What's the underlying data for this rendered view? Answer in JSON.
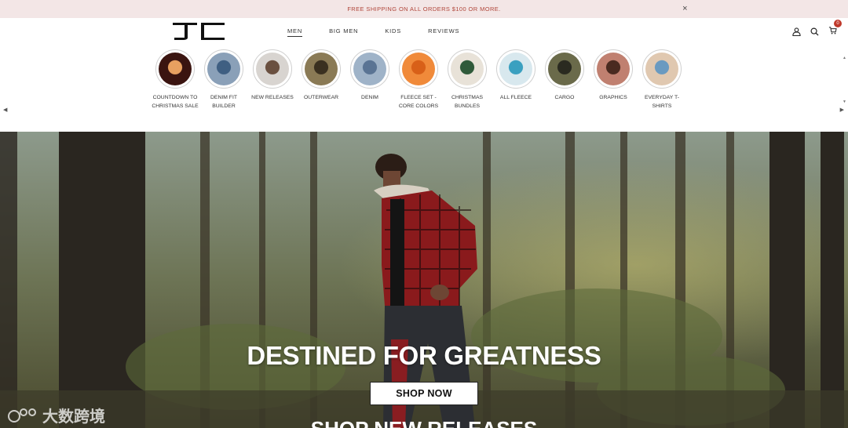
{
  "announcement": {
    "text": "FREE SHIPPING ON ALL ORDERS $100 OR MORE.",
    "close": "×"
  },
  "nav": {
    "items": [
      "MEN",
      "BIG MEN",
      "KIDS",
      "REVIEWS"
    ],
    "active": "MEN"
  },
  "cart": {
    "count": "0"
  },
  "categories": [
    {
      "label": "COUNTDOWN TO CHRISTMAS SALE",
      "color": "#3a1410",
      "accent": "#e8a060"
    },
    {
      "label": "DENIM FIT BUILDER",
      "color": "#8aa0b8",
      "accent": "#3f5f82"
    },
    {
      "label": "NEW RELEASES",
      "color": "#d8d4d0",
      "accent": "#6a5040"
    },
    {
      "label": "OUTERWEAR",
      "color": "#8a7a55",
      "accent": "#3a3020"
    },
    {
      "label": "DENIM",
      "color": "#9fb3c8",
      "accent": "#5a7494"
    },
    {
      "label": "FLEECE SET - CORE COLORS",
      "color": "#f08a3a",
      "accent": "#d86018"
    },
    {
      "label": "CHRISTMAS BUNDLES",
      "color": "#e8e2d8",
      "accent": "#2f5a3a"
    },
    {
      "label": "ALL FLEECE",
      "color": "#d8e8ee",
      "accent": "#3aa0c0"
    },
    {
      "label": "CARGO",
      "color": "#6a6a4a",
      "accent": "#2a2a20"
    },
    {
      "label": "GRAPHICS",
      "color": "#c08070",
      "accent": "#4a2a20"
    },
    {
      "label": "EVERYDAY T-SHIRTS",
      "color": "#e0c8b0",
      "accent": "#6a9ac0"
    }
  ],
  "hero": {
    "headline": "DESTINED FOR GREATNESS",
    "cta": "SHOP NOW",
    "subheading": "SHOP NEW RELEASES"
  },
  "watermark": {
    "text": "大数跨境"
  },
  "colors": {
    "announce_bg": "#f3e6e6",
    "announce_text": "#b0463a",
    "badge": "#c0392b"
  }
}
